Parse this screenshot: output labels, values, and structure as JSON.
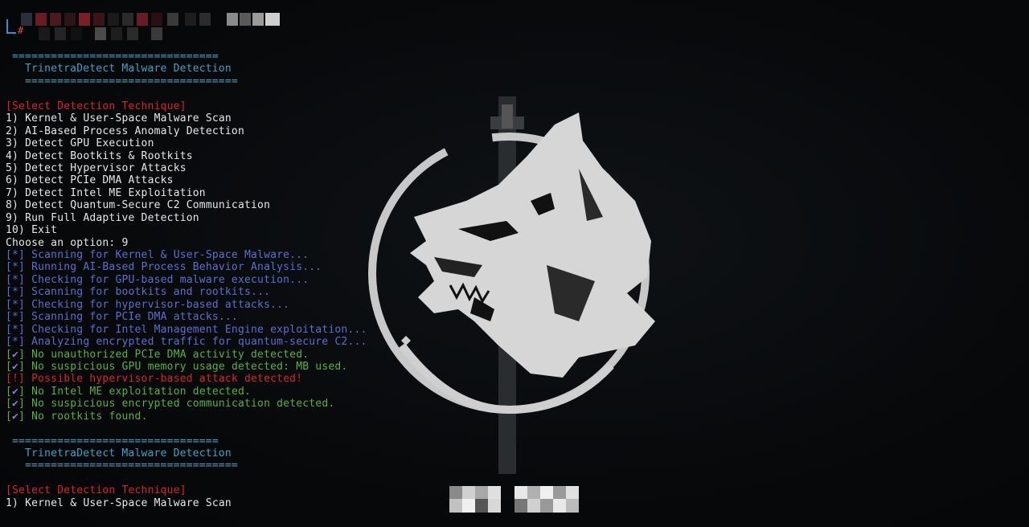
{
  "terminal": {
    "banner_rule_top": "================================",
    "banner_title": "TrinetraDetect Malware Detection",
    "banner_rule_bottom": "=================================",
    "menu_header": "[Select Detection Technique]",
    "menu": [
      "1) Kernel & User-Space Malware Scan",
      "2) AI-Based Process Anomaly Detection",
      "3) Detect GPU Execution",
      "4) Detect Bootkits & Rootkits",
      "5) Detect Hypervisor Attacks",
      "6) Detect PCIe DMA Attacks",
      "7) Detect Intel ME Exploitation",
      "8) Detect Quantum-Secure C2 Communication",
      "9) Run Full Adaptive Detection",
      "10) Exit"
    ],
    "choose_prompt": "Choose an option: 9",
    "progress": [
      "[*] Scanning for Kernel & User-Space Malware...",
      "[*] Running AI-Based Process Behavior Analysis...",
      "[*] Checking for GPU-based malware execution...",
      "[*] Scanning for bootkits and rootkits...",
      "[*] Checking for hypervisor-based attacks...",
      "[*] Scanning for PCIe DMA attacks...",
      "[*] Checking for Intel Management Engine exploitation...",
      "[*] Analyzing encrypted traffic for quantum-secure C2..."
    ],
    "result_1": "No unauthorized PCIe DMA activity detected.",
    "result_2": "No suspicious GPU memory usage detected: MB used.",
    "warning": "[!] Possible hypervisor-based attack detected!",
    "result_3": "No Intel ME exploitation detected.",
    "result_4": "No suspicious encrypted communication detected.",
    "result_5": "No rootkits found.",
    "banner2_rule_top": "================================",
    "banner2_title": "TrinetraDetect Malware Detection",
    "banner2_rule_bottom": "=================================",
    "menu2_header": "[Select Detection Technique]",
    "menu2_first": "1) Kernel & User-Space Malware Scan",
    "prompt_hash": "#"
  },
  "colors": {
    "background": "#07090b",
    "cyan": "#3ea2c6",
    "red": "#d8242f",
    "blue": "#5b6fd0",
    "green": "#57b23e",
    "white": "#e7e7e7"
  },
  "icons": {
    "wallpaper": "wolf-medallion-icon",
    "check": "checkmark-icon"
  }
}
